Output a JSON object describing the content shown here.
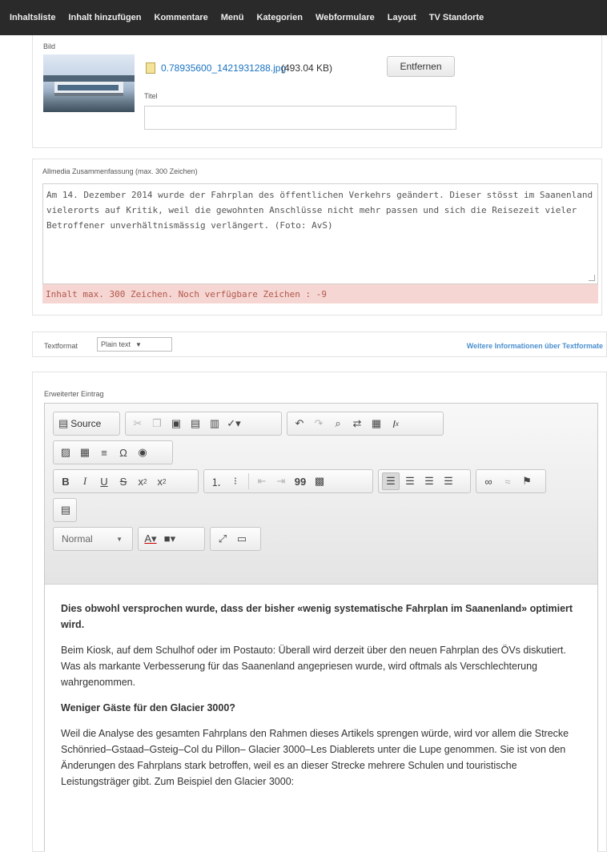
{
  "nav": {
    "items": [
      "Inhaltsliste",
      "Inhalt hinzufügen",
      "Kommentare",
      "Menü",
      "Kategorien",
      "Webformulare",
      "Layout",
      "TV Standorte"
    ]
  },
  "image_panel": {
    "label": "Bild",
    "file_name": "0.78935600_1421931288.jpg",
    "file_size": "(493.04 KB)",
    "remove_label": "Entfernen",
    "title_label": "Titel",
    "title_value": ""
  },
  "summary": {
    "label": "Allmedia Zusammenfassung (max. 300 Zeichen)",
    "text": "Am 14. Dezember 2014 wurde der Fahrplan des öffentlichen Verkehrs geändert. Dieser stösst im Saanenland vielerorts auf Kritik, weil die gewohnten Anschlüsse nicht mehr passen und sich die Reisezeit vieler Betroffener unverhältnismässig verlängert. (Foto: AvS)",
    "warning": "Inhalt max. 300 Zeichen. Noch verfügbare Zeichen : -9"
  },
  "text_format": {
    "label": "Textformat",
    "selected": "Plain text",
    "info_link": "Weitere Informationen über Textformate"
  },
  "extended": {
    "label": "Erweiterter Eintrag",
    "source_label": "Source",
    "format_combo": "Normal",
    "heading": "Dies obwohl versprochen wurde, dass der bisher «wenig systematische Fahrplan im Saanenland» optimiert wird.",
    "para1": "Beim Kiosk, auf dem Schulhof oder im Postauto: Überall wird derzeit über den neuen Fahrplan des ÖVs diskutiert. Was als markante Verbesserung für das Saanenland angepriesen wurde, wird oftmals als Verschlechterung wahrgenommen.",
    "subheading": "Weniger Gäste für den Glacier 3000?",
    "para2": "Weil die Analyse des gesamten Fahrplans den Rahmen dieses Artikels sprengen würde, wird vor allem die Strecke Schönried–Gstaad–Gsteig–Col du Pillon– Glacier 3000–Les Diablerets unter die Lupe genommen. Sie ist von den Änderungen des Fahrplans stark betroffen, weil es an dieser Strecke mehrere Schulen und touristische Leistungsträger gibt. Zum Beispiel den Glacier 3000:"
  },
  "colors": {
    "nav_bg": "#2a2a2a",
    "link": "#1a73c2",
    "warning_bg": "#f6d6d2",
    "warning_text": "#b0584e"
  }
}
